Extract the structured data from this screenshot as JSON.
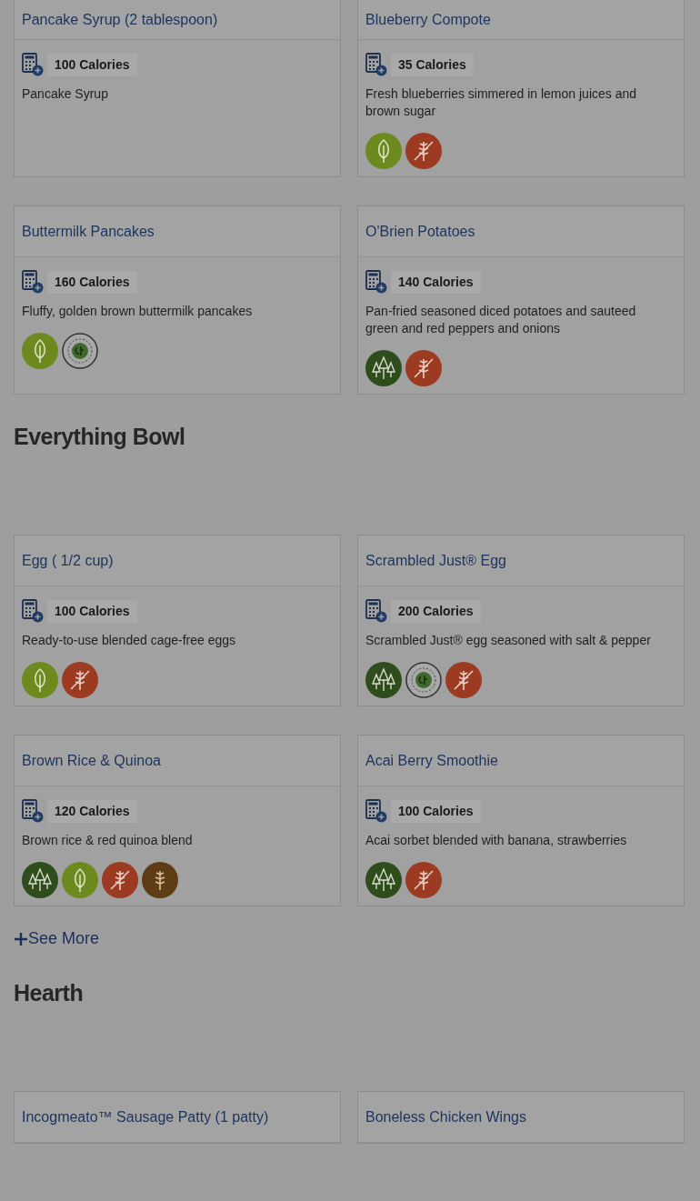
{
  "sections": [
    {
      "cards": [
        {
          "title": "Pancake Syrup (2 tablespoon)",
          "calories": "100 Calories",
          "description": "Pancake Syrup"
        },
        {
          "title": "Blueberry Compote",
          "calories": "35 Calories",
          "description": "Fresh blueberries simmered in lemon juices and brown sugar",
          "badges": [
            {
              "kind": "vegetarian"
            },
            {
              "kind": "gluten_free"
            }
          ]
        },
        {
          "title": "Buttermilk Pancakes",
          "calories": "160 Calories",
          "description": "Fluffy, golden brown buttermilk pancakes",
          "badges": [
            {
              "kind": "vegetarian"
            },
            {
              "kind": "low_carbon"
            }
          ]
        },
        {
          "title": "O'Brien Potatoes",
          "calories": "140 Calories",
          "description": "Pan-fried seasoned diced potatoes and sauteed green and red peppers and onions",
          "badges": [
            {
              "kind": "vegan"
            },
            {
              "kind": "gluten_free"
            }
          ]
        }
      ]
    },
    {
      "heading": "Everything Bowl",
      "cards": [
        {
          "title": "Egg ( 1/2 cup)",
          "calories": "100 Calories",
          "description": "Ready-to-use blended cage-free eggs",
          "badges": [
            {
              "kind": "vegetarian"
            },
            {
              "kind": "gluten_free"
            }
          ]
        },
        {
          "title": "Scrambled Just® Egg",
          "calories": "200 Calories",
          "description": "Scrambled Just® egg seasoned with salt & pepper",
          "badges": [
            {
              "kind": "vegan"
            },
            {
              "kind": "low_carbon"
            },
            {
              "kind": "gluten_free"
            }
          ]
        },
        {
          "title": "Brown Rice & Quinoa",
          "calories": "120 Calories",
          "description": "Brown rice & red quinoa blend",
          "badges": [
            {
              "kind": "vegan"
            },
            {
              "kind": "vegetarian"
            },
            {
              "kind": "gluten_free"
            },
            {
              "kind": "whole_grain"
            }
          ]
        },
        {
          "title": "Acai Berry Smoothie",
          "calories": "100 Calories",
          "description": "Acai sorbet blended with banana, strawberries",
          "badges": [
            {
              "kind": "vegan"
            },
            {
              "kind": "gluten_free"
            }
          ]
        }
      ],
      "see_more": "See More"
    },
    {
      "heading": "Hearth",
      "cards": [
        {
          "title": "Incogmeato™ Sausage Patty (1 patty)"
        },
        {
          "title": "Boneless Chicken Wings"
        }
      ]
    }
  ]
}
